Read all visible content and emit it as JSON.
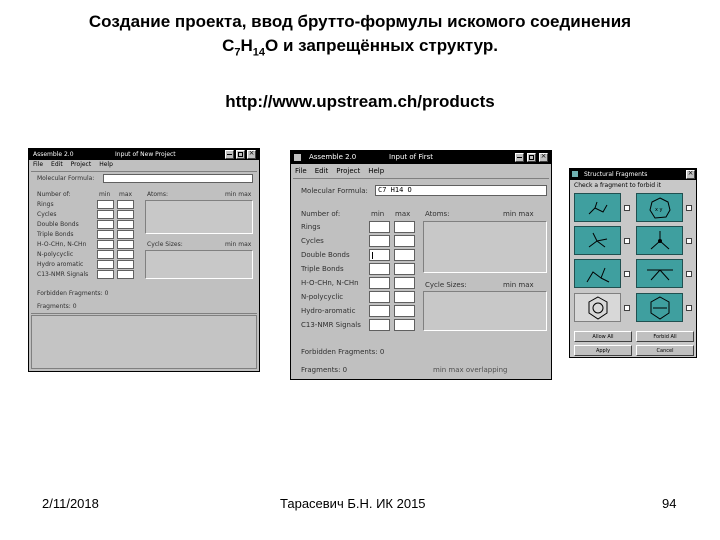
{
  "slide": {
    "title_line1": "Создание проекта, ввод брутто-формулы искомого соединения",
    "title_line2_parts": [
      "C",
      "7",
      "H",
      "14",
      "O и  запрещённых структур."
    ],
    "url": "http://www.upstream.ch/products",
    "date": "2/11/2018",
    "author": "Тарасевич Б.Н.  ИК 2015",
    "page": "94"
  },
  "win1": {
    "title": "Assemble 2.0",
    "subtitle": "Input of New Project",
    "menu": [
      "File",
      "Edit",
      "Project",
      "Help"
    ],
    "molecular_formula_label": "Molecular Formula:",
    "number_of": "Number of:",
    "min": "min",
    "max": "max",
    "atoms": "Atoms:",
    "min_max": "min   max",
    "rows": [
      "Rings",
      "Cycles",
      "Double Bonds",
      "Triple Bonds",
      "H-O-CHn, N-CHn",
      "N-polycyclic",
      "Hydro aromatic",
      "C13-NMR Signals"
    ],
    "cycle_sizes": "Cycle Sizes:",
    "forbidden": "Forbidden Fragments: 0",
    "fragments": "Fragments: 0"
  },
  "win2": {
    "title": "Assemble 2.0",
    "subtitle": "Input of First",
    "menu": [
      "File",
      "Edit",
      "Project",
      "Help"
    ],
    "molecular_formula_label": "Molecular Formula:",
    "formula_value": "C7 H14 O",
    "number_of": "Number of:",
    "min": "min",
    "max": "max",
    "atoms": "Atoms:",
    "min_max": "min   max",
    "rows": [
      "Rings",
      "Cycles",
      "Double Bonds",
      "Triple Bonds",
      "H-O-CHn, N-CHn",
      "N-polycyclic",
      "Hydro-aromatic",
      "C13-NMR Signals"
    ],
    "cycle_sizes": "Cycle Sizes:",
    "cycle_min_max": "min   max",
    "forbidden": "Forbidden Fragments: 0",
    "fragments": "Fragments: 0",
    "bottom_status": "min     max    overlapping"
  },
  "win3": {
    "title": "Structural Fragments",
    "instruction": "Check a fragment to forbid it",
    "allow_all": "Allow All",
    "forbid_all": "Forbid All",
    "apply": "Apply",
    "cancel": "Cancel"
  }
}
